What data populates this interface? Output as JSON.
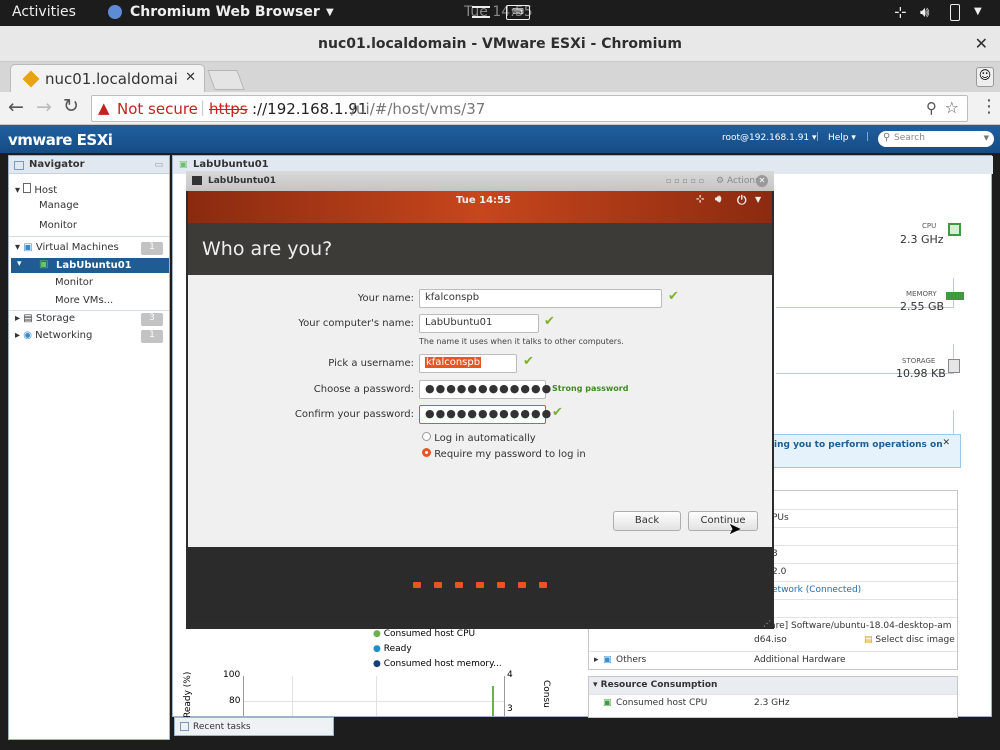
{
  "gnome": {
    "activities": "Activities",
    "app": "Chromium Web Browser",
    "clock": "Tue 14:55"
  },
  "window": {
    "title": "nuc01.localdomain - VMware ESXi - Chromium"
  },
  "browser": {
    "tab_title": "nuc01.localdomai",
    "security": "Not secure",
    "url_scheme": "https",
    "url_host": "://192.168.1.91",
    "url_path": "/ui/#/host/vms/37"
  },
  "esxi": {
    "logo": "vmware ESXi",
    "user": "root@192.168.1.91 ▾",
    "help": "Help ▾",
    "search_placeholder": "Search"
  },
  "navigator": {
    "title": "Navigator",
    "host": "Host",
    "manage": "Manage",
    "monitor": "Monitor",
    "vms": "Virtual Machines",
    "vms_count": "1",
    "vm_selected": "LabUbuntu01",
    "vm_monitor": "Monitor",
    "more_vms": "More VMs...",
    "storage": "Storage",
    "storage_count": "3",
    "networking": "Networking",
    "networking_count": "1"
  },
  "main": {
    "title": "LabUbuntu01",
    "cpu_label": "CPU",
    "cpu_value": "2.3 GHz",
    "mem_label": "MEMORY",
    "mem_value": "2.55 GB",
    "storage_label": "STORAGE",
    "storage_value": "10.98 KB",
    "notice": "ing you to perform operations on",
    "hw_rows": [
      "PUs",
      "",
      "3",
      "2.0",
      "etwork (Connected)",
      "",
      "mware] Software/ubuntu-18.04-desktop-am",
      "d64.iso"
    ],
    "select_disc": "Select disc image",
    "others_label": "Others",
    "others_value": "Additional Hardware",
    "resource_title": "Resource Consumption",
    "consumed_cpu_label": "Consumed host CPU",
    "consumed_cpu_value": "2.3 GHz",
    "legend": [
      "Consumed host CPU",
      "Ready",
      "Consumed host memory..."
    ],
    "y_axis_label": "Ready (%)",
    "y_ticks": [
      "100",
      "80"
    ],
    "right_ticks": [
      "4",
      "3"
    ],
    "right_axis_label": "Consu",
    "recent_tasks": "Recent tasks"
  },
  "console": {
    "title": "LabUbuntu01",
    "actions": "Actions",
    "clock": "Tue 14:55",
    "heading": "Who are you?",
    "name_label": "Your name:",
    "name_value": "kfalconspb",
    "computer_label": "Your computer's name:",
    "computer_value": "LabUbuntu01",
    "computer_hint": "The name it uses when it talks to other computers.",
    "username_label": "Pick a username:",
    "username_value": "kfalconspb",
    "password_label": "Choose a password:",
    "password_value": "●●●●●●●●●●●●",
    "strength": "Strong password",
    "confirm_label": "Confirm your password:",
    "confirm_value": "●●●●●●●●●●●●",
    "login_auto": "Log in automatically",
    "login_require": "Require my password to log in",
    "back": "Back",
    "continue": "Continue"
  },
  "colors": {
    "ubuntu_orange": "#e95420",
    "esxi_blue": "#1a5590",
    "check_green": "#7bb325"
  }
}
